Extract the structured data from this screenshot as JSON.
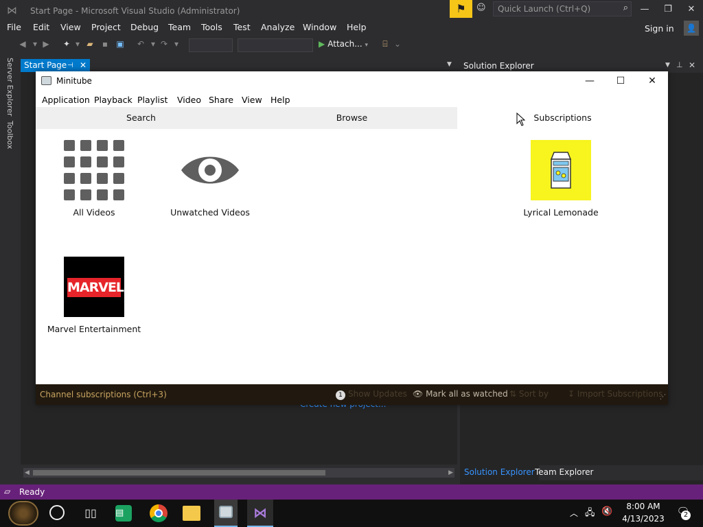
{
  "vs": {
    "title": "Start Page - Microsoft Visual Studio  (Administrator)",
    "quick_launch_placeholder": "Quick Launch (Ctrl+Q)",
    "sign_in": "Sign in",
    "menu": [
      "File",
      "Edit",
      "View",
      "Project",
      "Debug",
      "Team",
      "Tools",
      "Test",
      "Analyze",
      "Window",
      "Help"
    ],
    "attach_label": "Attach...",
    "side_tabs": [
      "Server Explorer",
      "Toolbox"
    ],
    "doc_tab": "Start Page",
    "create_project_link": "Create new project...",
    "solution_explorer_title": "Solution Explorer",
    "bottom_tabs": [
      "Solution Explorer",
      "Team Explorer"
    ],
    "status": "Ready",
    "accent": "#007acc",
    "status_color": "#68217a"
  },
  "minitube": {
    "title": "Minitube",
    "menu": [
      "Application",
      "Playback",
      "Playlist",
      "Video",
      "Share",
      "View",
      "Help"
    ],
    "tabs": [
      {
        "label": "Search",
        "active": false
      },
      {
        "label": "Browse",
        "active": false
      },
      {
        "label": "Subscriptions",
        "active": true
      }
    ],
    "channels": [
      {
        "label": "All Videos",
        "icon": "grid-icon"
      },
      {
        "label": "Unwatched Videos",
        "icon": "eye-icon"
      },
      {
        "label": "Lyrical Lemonade",
        "icon": "lemonade-carton-icon"
      },
      {
        "label": "Marvel Entertainment",
        "icon": "marvel-logo"
      }
    ],
    "marvel_logo_text": "MARVEL",
    "bottom_bar": {
      "status": "Channel subscriptions (Ctrl+3)",
      "updates_count": "1",
      "show_updates": "Show Updates",
      "mark_all_watched": "Mark all as watched",
      "sort_by": "Sort by",
      "import": "Import Subscriptions"
    }
  },
  "taskbar": {
    "time": "8:00 AM",
    "date": "4/13/2023",
    "notification_count": "2"
  }
}
